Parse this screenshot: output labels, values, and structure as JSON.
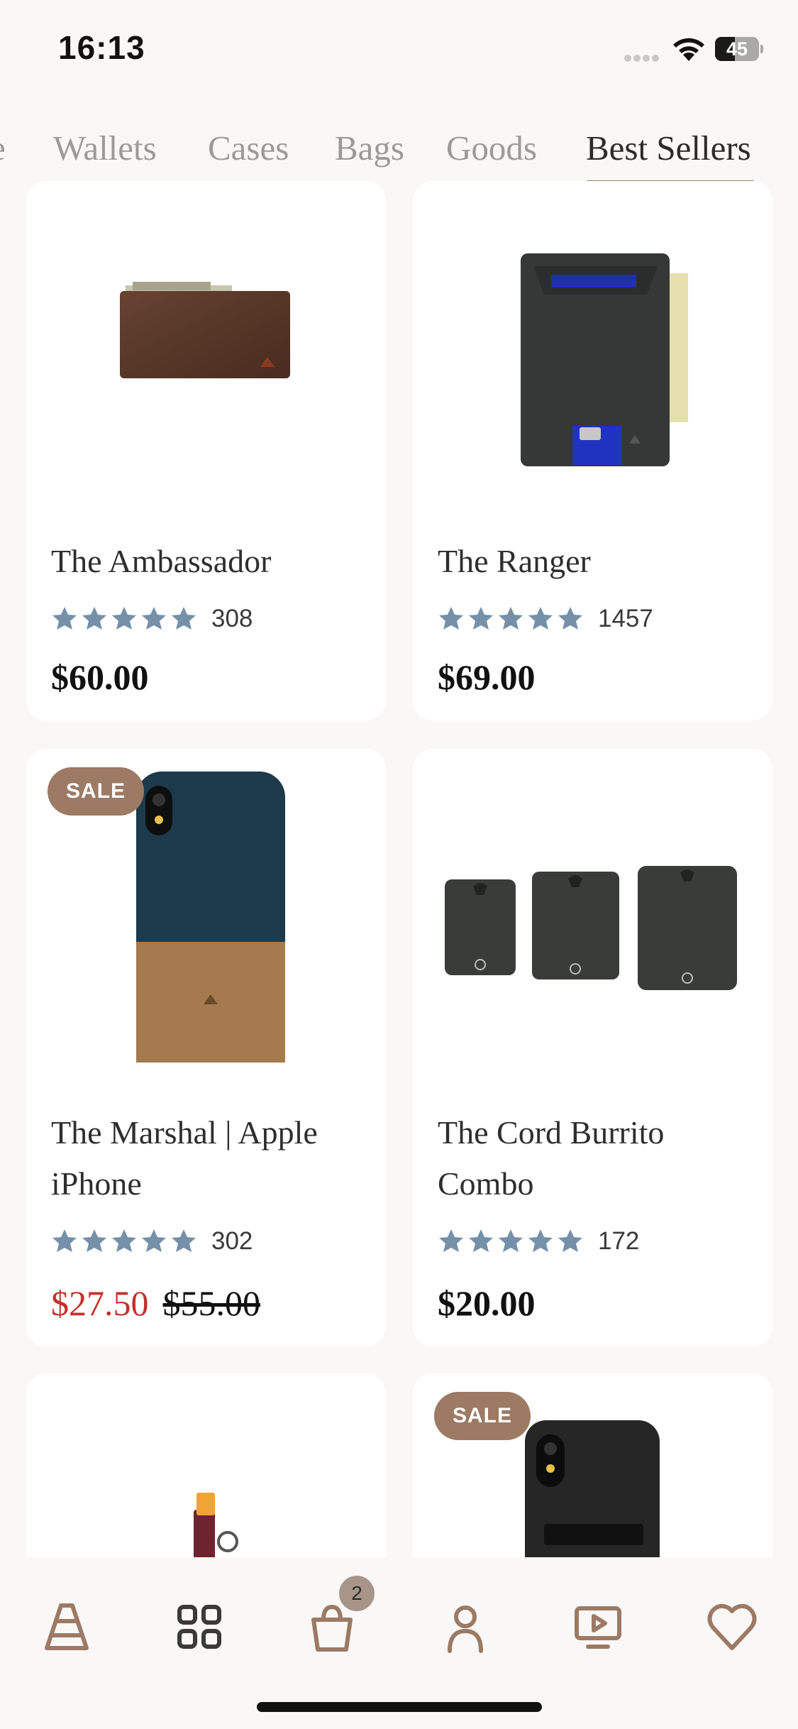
{
  "status_bar": {
    "time": "16:13",
    "battery": "45",
    "battery_level": 0.45
  },
  "tabs": [
    {
      "label": "e"
    },
    {
      "label": "Wallets"
    },
    {
      "label": "Cases"
    },
    {
      "label": "Bags"
    },
    {
      "label": "Goods"
    },
    {
      "label": "Best Sellers",
      "active": true
    }
  ],
  "products": [
    {
      "name": "The Ambassador",
      "rating": 5,
      "reviews": "308",
      "price": "$60.00"
    },
    {
      "name": "The Ranger",
      "rating": 5,
      "reviews": "1457",
      "price": "$69.00"
    },
    {
      "name": "The Marshal | Apple iPhone",
      "rating": 5,
      "reviews": "302",
      "sale_price": "$27.50",
      "compare_price": "$55.00",
      "badge": "SALE"
    },
    {
      "name": "The Cord Burrito Combo",
      "rating": 5,
      "reviews": "172",
      "price": "$20.00"
    },
    {
      "name": "",
      "badge": ""
    },
    {
      "name": "",
      "badge": "SALE"
    }
  ],
  "bottom_nav": {
    "items": [
      "home-icon",
      "categories-grid-icon",
      "shopping-bag-icon",
      "account-icon",
      "video-icon",
      "wishlist-heart-icon"
    ],
    "cart_count": "2"
  },
  "colors": {
    "accent": "#9c7a64",
    "star": "#7590a8",
    "sale": "#c4302b",
    "background": "#faf8f6"
  }
}
